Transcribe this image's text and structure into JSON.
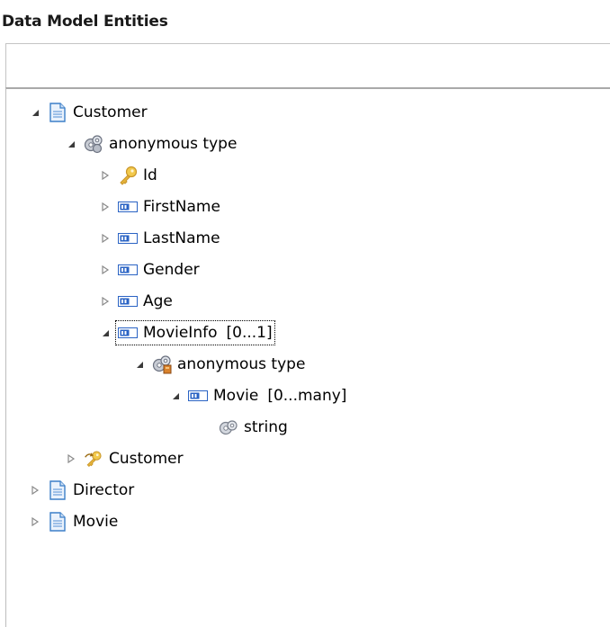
{
  "panel": {
    "title": "Data Model Entities",
    "filter_value": "",
    "filter_placeholder": ""
  },
  "tree": {
    "customer_root": "Customer",
    "anon_type_1": "anonymous type",
    "id": "Id",
    "first_name": "FirstName",
    "last_name": "LastName",
    "gender": "Gender",
    "age": "Age",
    "movie_info": "MovieInfo",
    "movie_info_mult": "[0...1]",
    "anon_type_2": "anonymous type",
    "movie": "Movie",
    "movie_mult": "[0...many]",
    "string_type": "string",
    "customer_key": "Customer",
    "director_root": "Director",
    "movie_root": "Movie"
  },
  "icons": {
    "entity": "document-icon",
    "complex_type": "gears-icon",
    "key": "key-icon",
    "element": "field-icon",
    "fk": "foreign-key-icon",
    "simple_type": "simple-type-icon"
  },
  "colors": {
    "accent_blue": "#3c7fc8",
    "key_yellow": "#e6b43a",
    "field_blue": "#2a63c4"
  }
}
